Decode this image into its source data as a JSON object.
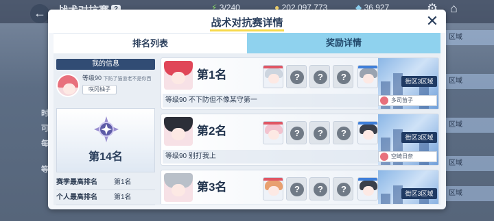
{
  "background": {
    "title": "战术对抗赛",
    "help_icon": "question-icon",
    "resources": [
      {
        "icon": "ap-icon",
        "value": "3/240"
      },
      {
        "icon": "credit-icon",
        "value": "202,097,773"
      },
      {
        "icon": "gem-icon",
        "value": "36,927"
      }
    ],
    "left_labels": [
      "时",
      "可",
      "每",
      "等"
    ],
    "right_tabs": [
      "区域",
      "区域",
      "区域",
      "区域",
      "区域"
    ]
  },
  "modal": {
    "title": "战术对抗赛详情",
    "close_icon": "close-icon",
    "tabs": [
      {
        "label": "排名列表",
        "active": true
      },
      {
        "label": "奖励详情",
        "active": false
      }
    ]
  },
  "my_info": {
    "header": "我的信息",
    "level": "等级90",
    "comment": "下防了猫道老不是你西",
    "name": "咲冈柚子",
    "rank_label": "第14名",
    "stats": [
      {
        "label": "赛季最高排名",
        "value": "第1名"
      },
      {
        "label": "个人最高排名",
        "value": "第1名"
      }
    ]
  },
  "rankings": [
    {
      "rank": "第1名",
      "level_comment": "等级90  不下防但不像某守第一",
      "zone": "街区3区域",
      "partner_name": "多司苗子",
      "avatar_hair": "#e04658",
      "team": [
        "filled",
        "empty",
        "empty",
        "empty",
        "filled",
        "filled"
      ],
      "team_colors": [
        "#cdd5df",
        "",
        "",
        "",
        "#9aa3b0",
        "#2f3440"
      ]
    },
    {
      "rank": "第2名",
      "level_comment": "等级90  别打我上",
      "zone": "街区3区域",
      "partner_name": "空崎日奈",
      "avatar_hair": "#2c2f38",
      "team": [
        "filled",
        "empty",
        "empty",
        "empty",
        "filled",
        "filled"
      ],
      "team_colors": [
        "#f2c3cf",
        "",
        "",
        "",
        "#3a3f4a",
        "#d9dde3"
      ]
    },
    {
      "rank": "第3名",
      "level_comment": "",
      "zone": "街区3区域",
      "partner_name": "",
      "avatar_hair": "#b9c0c9",
      "team": [
        "filled",
        "empty",
        "empty",
        "empty",
        "filled",
        "filled"
      ],
      "team_colors": [
        "#e8a070",
        "",
        "",
        "",
        "#3a3f4a",
        "#8fd8d8"
      ]
    }
  ]
}
